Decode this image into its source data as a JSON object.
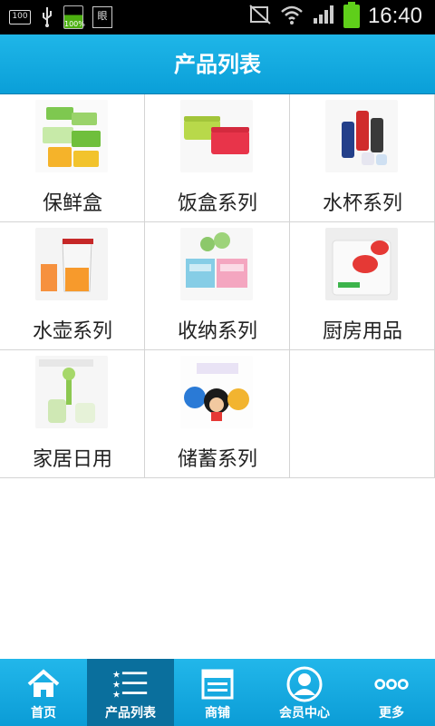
{
  "status_bar": {
    "battery_small_text": "100",
    "battery_percent": "100%",
    "doc_icon_text": "眼",
    "time": "16:40"
  },
  "header": {
    "title": "产品列表"
  },
  "products": [
    {
      "label": "保鲜盒",
      "icon": "food-container-thumbnail"
    },
    {
      "label": "饭盒系列",
      "icon": "lunchbox-thumbnail"
    },
    {
      "label": "水杯系列",
      "icon": "water-cup-thumbnail"
    },
    {
      "label": "水壶系列",
      "icon": "water-jug-thumbnail"
    },
    {
      "label": "收纳系列",
      "icon": "storage-box-thumbnail"
    },
    {
      "label": "厨房用品",
      "icon": "cutting-board-thumbnail"
    },
    {
      "label": "家居日用",
      "icon": "household-thumbnail"
    },
    {
      "label": "储蓄系列",
      "icon": "piggy-bank-thumbnail"
    }
  ],
  "tabs": [
    {
      "label": "首页",
      "icon": "home-icon"
    },
    {
      "label": "产品列表",
      "icon": "list-icon",
      "active": true
    },
    {
      "label": "商铺",
      "icon": "shop-icon"
    },
    {
      "label": "会员中心",
      "icon": "member-icon"
    },
    {
      "label": "更多",
      "icon": "more-icon"
    }
  ],
  "colors": {
    "header": "#12ace2",
    "tabbar": "#16aae2",
    "tab_active": "#0a6f9d"
  }
}
